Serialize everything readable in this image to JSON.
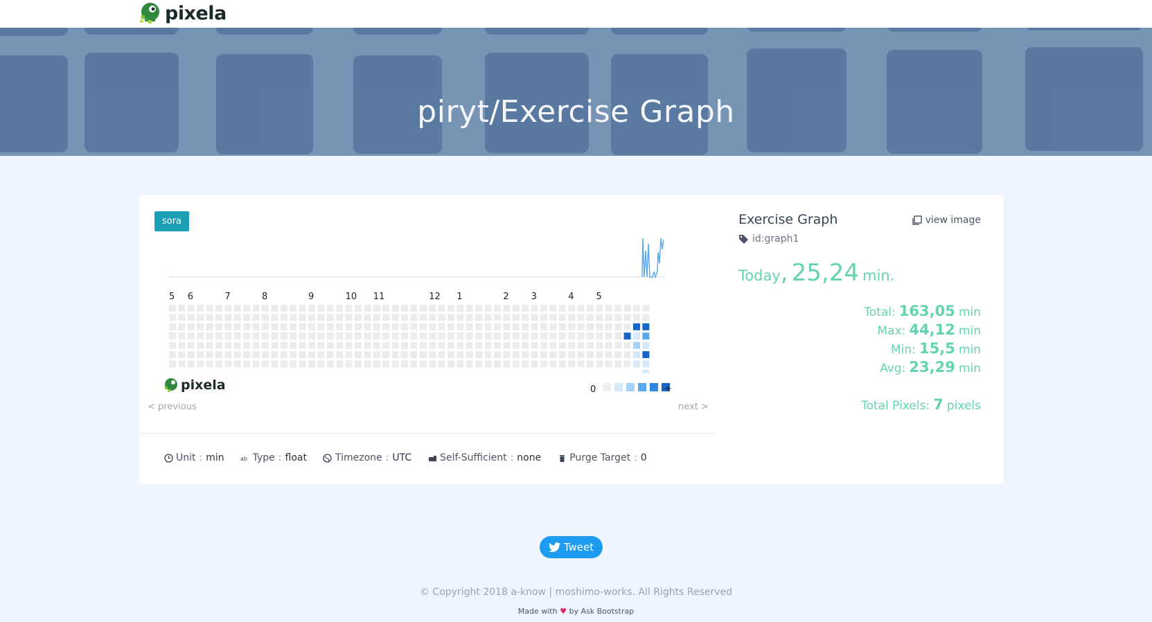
{
  "brand": {
    "name": "pixela"
  },
  "hero": {
    "title": "piryt/Exercise Graph"
  },
  "graph": {
    "badge": "sora",
    "month_labels": [
      "5",
      "6",
      "7",
      "8",
      "9",
      "10",
      "11",
      "12",
      "1",
      "2",
      "3",
      "4",
      "5"
    ],
    "legend_min": "0",
    "legend_max": "+",
    "legend_colors": [
      "#eeeeee",
      "#d6e9fb",
      "#a8d3f7",
      "#5aaaf0",
      "#2e86de",
      "#1566c7"
    ],
    "empty_color": "#ececec",
    "previous_label": "< previous",
    "next_label": "next >",
    "watermark": "pixela"
  },
  "meta": [
    {
      "label": "Unit",
      "value": "min",
      "icon": "clock-icon"
    },
    {
      "label": "Type",
      "value": "float",
      "icon": "type-icon"
    },
    {
      "label": "Timezone",
      "value": "UTC",
      "icon": "globe-icon"
    },
    {
      "label": "Self-Sufficient",
      "value": "none",
      "icon": "car-icon"
    },
    {
      "label": "Purge Target",
      "value": "0",
      "icon": "trash-icon"
    }
  ],
  "side": {
    "title": "Exercise Graph",
    "view_image": "view image",
    "graph_id": "id:graph1",
    "today_label": "Today",
    "today_comma": ",",
    "today_value": "25,24",
    "today_unit": "min.",
    "stats": [
      {
        "label": "Total:",
        "value": "163,05",
        "unit": "min"
      },
      {
        "label": "Max:",
        "value": "44,12",
        "unit": "min"
      },
      {
        "label": "Min:",
        "value": "15,5",
        "unit": "min"
      },
      {
        "label": "Avg:",
        "value": "23,29",
        "unit": "min"
      }
    ],
    "total_pixels_label": "Total Pixels:",
    "total_pixels_value": "7",
    "total_pixels_unit": "pixels",
    "accent_color": "#64d3b2"
  },
  "footer": {
    "tweet": "Tweet",
    "copyright": "© Copyright 2018 a-know | moshimo-works. All Rights Reserved",
    "made_with_prefix": "Made with",
    "made_with_suffix": "by Ask Bootstrap"
  }
}
